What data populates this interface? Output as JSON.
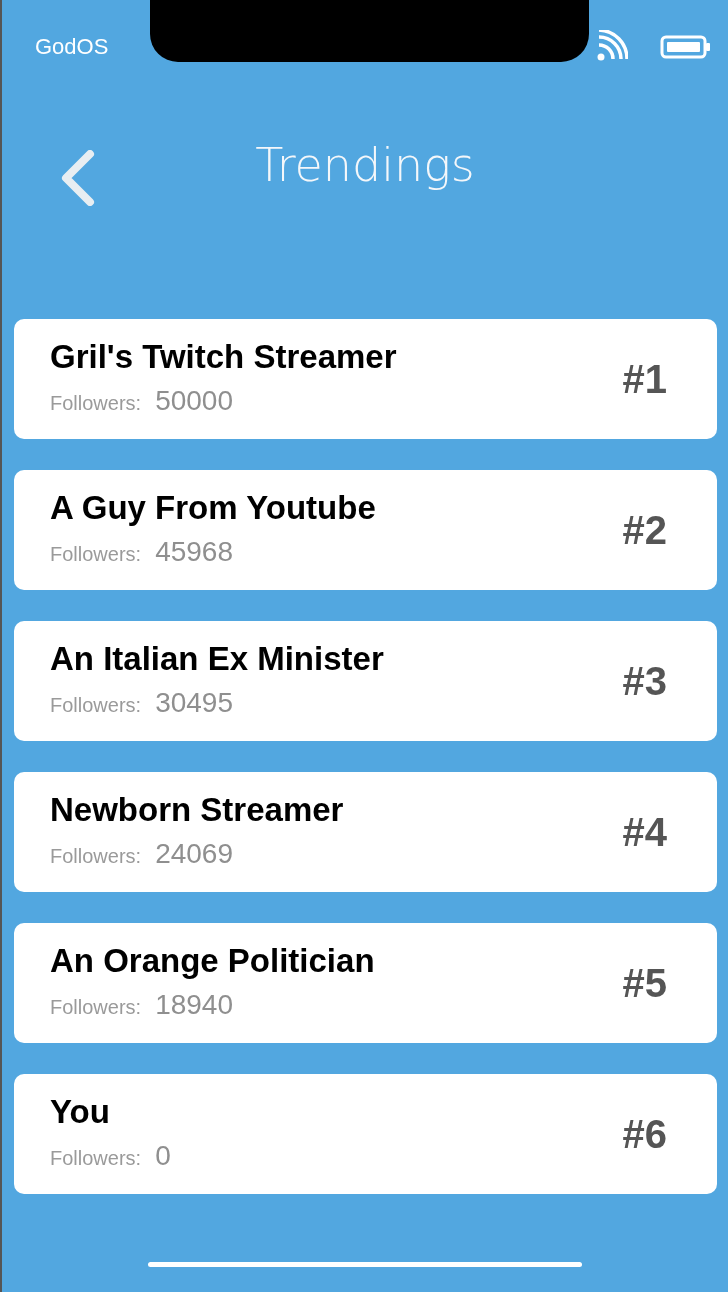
{
  "status_bar": {
    "carrier": "GodOS"
  },
  "header": {
    "title": "Trendings"
  },
  "trending": [
    {
      "name": "Gril's Twitch Streamer",
      "followers_label": "Followers:",
      "followers": "50000",
      "rank": "#1"
    },
    {
      "name": "A Guy From Youtube",
      "followers_label": "Followers:",
      "followers": "45968",
      "rank": "#2"
    },
    {
      "name": "An Italian Ex Minister",
      "followers_label": "Followers:",
      "followers": "30495",
      "rank": "#3"
    },
    {
      "name": "Newborn Streamer",
      "followers_label": "Followers:",
      "followers": "24069",
      "rank": "#4"
    },
    {
      "name": "An Orange Politician",
      "followers_label": "Followers:",
      "followers": "18940",
      "rank": "#5"
    },
    {
      "name": "You",
      "followers_label": "Followers:",
      "followers": "0",
      "rank": "#6"
    }
  ]
}
